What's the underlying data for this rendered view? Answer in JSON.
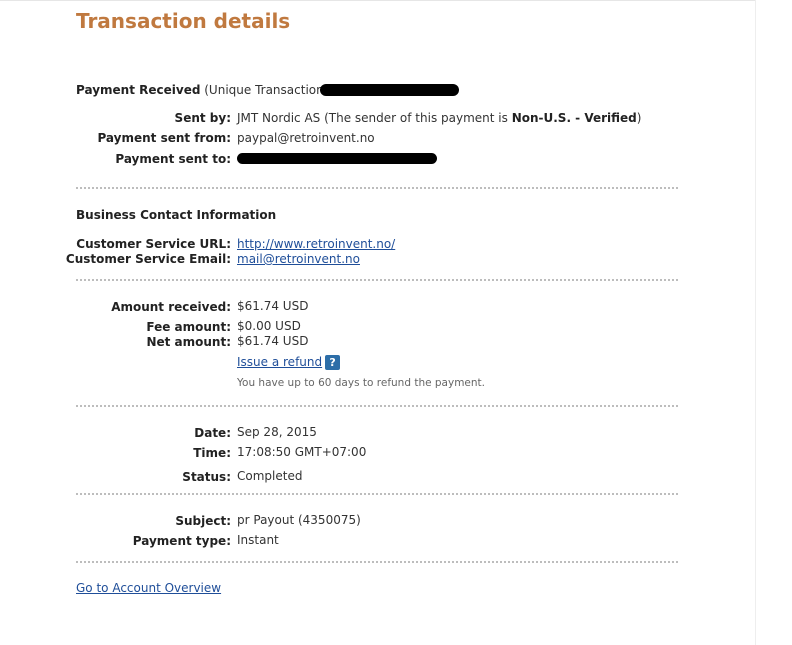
{
  "page": {
    "title": "Transaction details"
  },
  "payment": {
    "heading": "Payment Received",
    "txn_prefix": "(Unique Transaction ID #",
    "sent_by_label": "Sent by:",
    "sent_by_name": "JMT Nordic AS",
    "sent_by_note_prefix": "(The sender of this payment is",
    "sent_by_status": "Non-U.S. - Verified",
    "sent_by_note_suffix": ")",
    "sent_from_label": "Payment sent from:",
    "sent_from_value": "paypal@retroinvent.no",
    "sent_to_label": "Payment sent to:"
  },
  "business": {
    "heading": "Business Contact Information",
    "url_label": "Customer Service URL:",
    "url_value": "http://www.retroinvent.no/",
    "email_label": "Customer Service Email:",
    "email_value": "mail@retroinvent.no"
  },
  "amounts": {
    "received_label": "Amount received:",
    "received_value": "$61.74 USD",
    "fee_label": "Fee amount:",
    "fee_value": "$0.00 USD",
    "net_label": "Net amount:",
    "net_value": "$61.74 USD",
    "refund_link": "Issue a refund",
    "help_icon": "?",
    "refund_note": "You have up to 60 days to refund the payment."
  },
  "timing": {
    "date_label": "Date:",
    "date_value": "Sep 28, 2015",
    "time_label": "Time:",
    "time_value": "17:08:50 GMT+07:00",
    "status_label": "Status:",
    "status_value": "Completed"
  },
  "details": {
    "subject_label": "Subject:",
    "subject_value": "pr Payout (4350075)",
    "type_label": "Payment type:",
    "type_value": "Instant"
  },
  "footer": {
    "overview_link": "Go to Account Overview"
  },
  "colors": {
    "title": "#c0793f",
    "link": "#1f4e99",
    "help_icon_bg": "#2d6ea8"
  }
}
